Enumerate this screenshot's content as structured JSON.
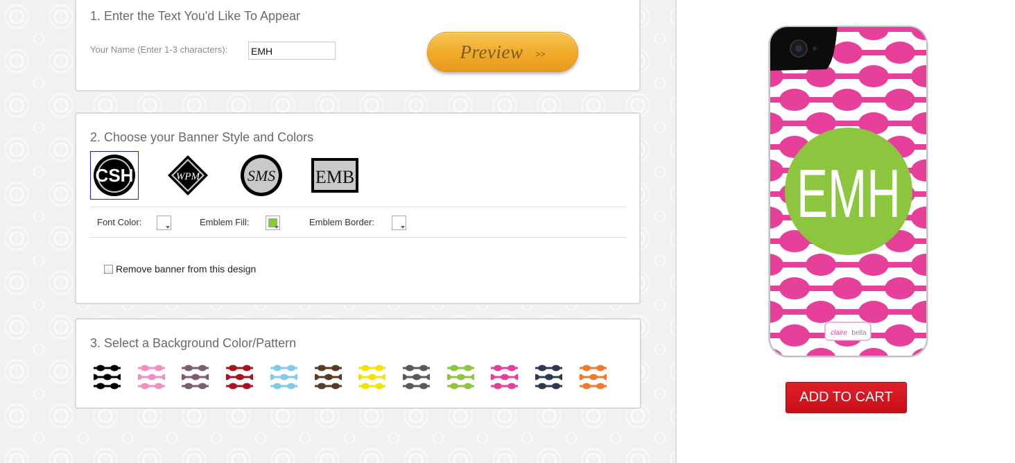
{
  "step1": {
    "title": "1. Enter the Text You'd Like To Appear",
    "name_label": "Your Name (Enter 1-3 characters):",
    "name_value": "EMH",
    "preview_label": "Preview",
    "preview_arrow": ">>"
  },
  "step2": {
    "title": "2. Choose your Banner Style and Colors",
    "emblems": [
      {
        "text": "CSH",
        "style": "circle-block",
        "selected": true
      },
      {
        "text": "WPM",
        "style": "diamond-script",
        "selected": false
      },
      {
        "text": "SMS",
        "style": "circle-script",
        "selected": false
      },
      {
        "text": "EMB",
        "style": "square-serif",
        "selected": false
      }
    ],
    "font_color_label": "Font Color:",
    "emblem_fill_label": "Emblem Fill:",
    "emblem_border_label": "Emblem Border:",
    "font_color": "#ffffff",
    "emblem_fill": "#8cc63f",
    "emblem_border": "#ffffff",
    "remove_banner_label": "Remove banner from this design",
    "remove_banner_checked": false
  },
  "step3": {
    "title": "3. Select a Background Color/Pattern",
    "patterns": [
      {
        "color": "#000000",
        "name": "black"
      },
      {
        "color": "#f08fc4",
        "name": "light-pink"
      },
      {
        "color": "#7b5e72",
        "name": "mauve"
      },
      {
        "color": "#a8151f",
        "name": "red"
      },
      {
        "color": "#7ecbea",
        "name": "light-blue"
      },
      {
        "color": "#5a3a22",
        "name": "brown"
      },
      {
        "color": "#f4e300",
        "name": "yellow"
      },
      {
        "color": "#5a5a5a",
        "name": "gray"
      },
      {
        "color": "#8cc63f",
        "name": "green"
      },
      {
        "color": "#e6409a",
        "name": "pink"
      },
      {
        "color": "#2d3a52",
        "name": "navy"
      },
      {
        "color": "#ee7a2a",
        "name": "orange"
      }
    ]
  },
  "preview": {
    "monogram": "EMH",
    "case_color": "#e6409a",
    "emblem_color": "#8cc63f",
    "brand_left": "claire",
    "brand_right": "bella"
  },
  "cart": {
    "label": "ADD TO CART"
  },
  "icons": {
    "dropdown": "triangle-down",
    "camera": "camera-lens"
  }
}
